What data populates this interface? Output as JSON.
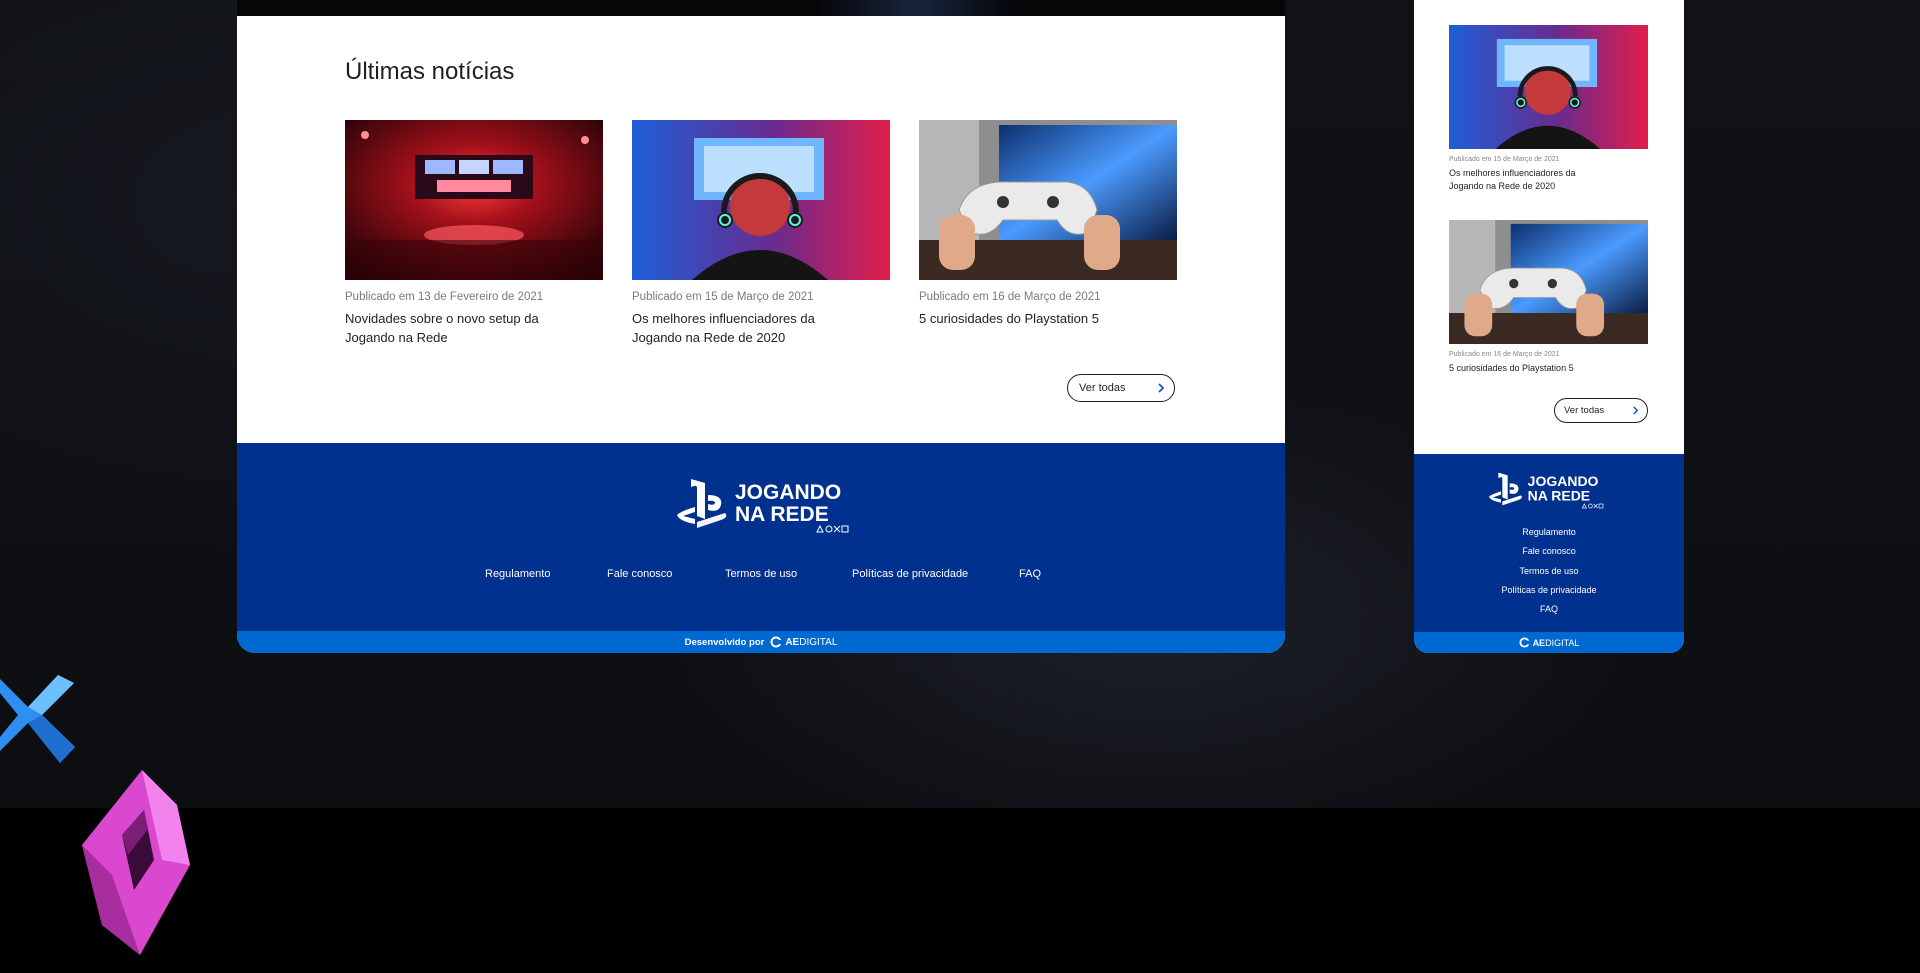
{
  "desktop": {
    "section_title": "Últimas notícias",
    "articles": [
      {
        "date": "Publicado em 13 de Fevereiro de 2021",
        "headline": "Novidades sobre o novo setup da Jogando na Rede"
      },
      {
        "date": "Publicado em 15 de Março de 2021",
        "headline": "Os melhores influenciadores da Jogando na Rede de 2020"
      },
      {
        "date": "Publicado em 16 de Março de 2021",
        "headline": "5 curiosidades do Playstation 5"
      }
    ],
    "see_all_label": "Ver todas",
    "footer": {
      "logo_line1": "JOGANDO",
      "logo_line2": "NA REDE",
      "nav": [
        "Regulamento",
        "Fale conosco",
        "Termos de uso",
        "Políticas de privacidade",
        "FAQ"
      ],
      "dev_label": "Desenvolvido por",
      "dev_brand_bold": "AE",
      "dev_brand_light": "DIGITAL"
    }
  },
  "mobile": {
    "articles": [
      {
        "date": "Publicado em 15 de Março de 2021",
        "headline": "Os melhores influenciadores da Jogando na Rede de 2020"
      },
      {
        "date": "Publicado em 16 de Março de 2021",
        "headline": "5 curiosidades do Playstation 5"
      }
    ],
    "see_all_label": "Ver todas",
    "footer": {
      "logo_line1": "JOGANDO",
      "logo_line2": "NA REDE",
      "nav": [
        "Regulamento",
        "Fale conosco",
        "Termos de uso",
        "Políticas de privacidade",
        "FAQ"
      ],
      "dev_brand_bold": "AE",
      "dev_brand_light": "DIGITAL"
    }
  },
  "colors": {
    "footer_blue": "#00318f",
    "dev_bar_blue": "#0068d1",
    "cross_blue": "#3aa0ff",
    "square_pink": "#e85ad8"
  },
  "icons": [
    "chevron-right-icon",
    "playstation-logo-icon",
    "ps-shapes-icon",
    "ae-digital-logo-icon",
    "cross-shape-icon",
    "square-shape-icon"
  ]
}
